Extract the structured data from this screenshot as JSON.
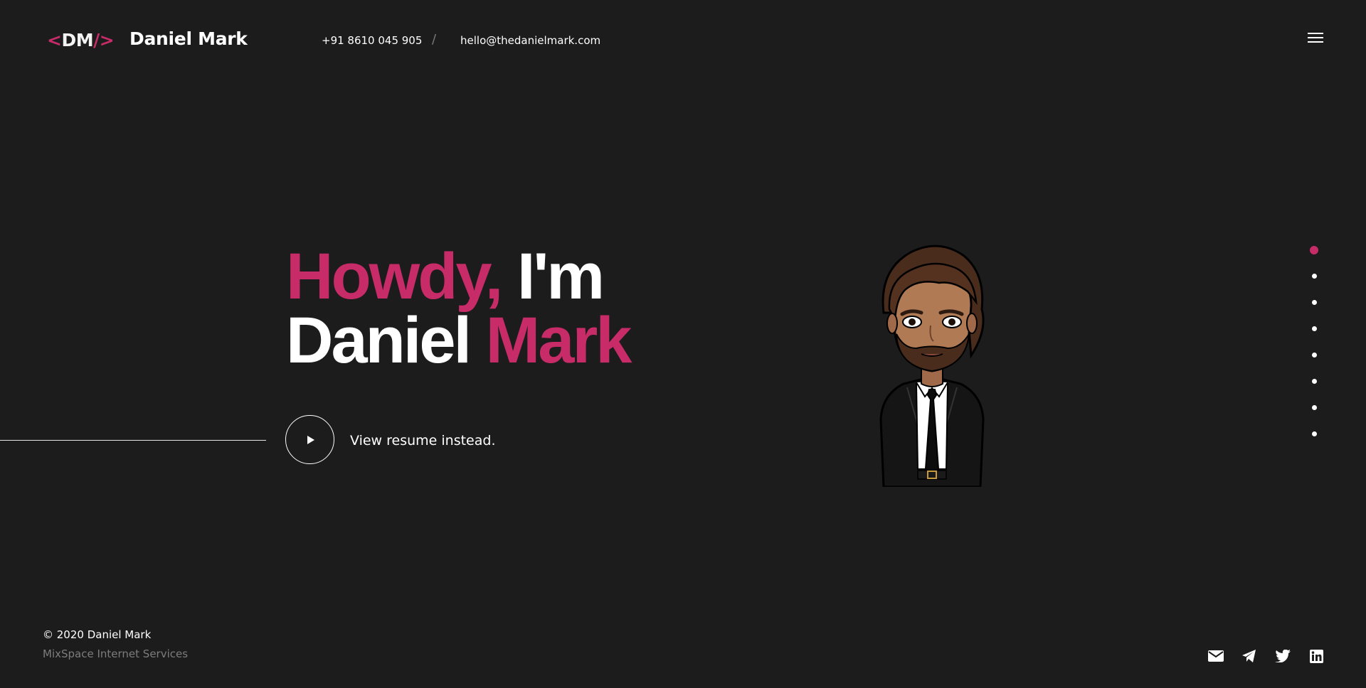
{
  "header": {
    "logo": {
      "lt": "<",
      "dm": "DM",
      "slash": "/",
      "gt": ">"
    },
    "brand_name": "Daniel Mark",
    "phone": "+91 8610 045 905",
    "divider": "/",
    "email": "hello@thedanielmark.com",
    "menu_icon": "hamburger-menu-icon"
  },
  "hero": {
    "line1_accent": "Howdy,",
    "line1_white": " I'm",
    "line2_white": "Daniel ",
    "line2_accent": "Mark",
    "cta_label": "View resume instead.",
    "cta_icon": "play-icon"
  },
  "side_nav": {
    "dots": 8,
    "active_index": 0
  },
  "footer": {
    "copyright": "© 2020 Daniel Mark",
    "company": "MixSpace Internet Services",
    "social_icons": [
      "mail-icon",
      "telegram-icon",
      "twitter-icon",
      "linkedin-icon"
    ]
  },
  "colors": {
    "background": "#1c1c1c",
    "accent": "#c72b68",
    "text": "#ffffff",
    "muted": "#7d7d7d"
  }
}
